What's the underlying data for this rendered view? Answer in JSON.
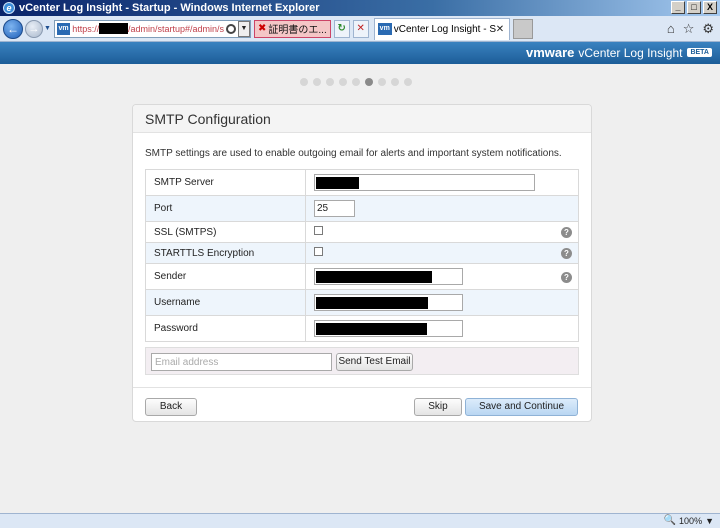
{
  "window": {
    "title": "vCenter Log Insight - Startup - Windows Internet Explorer",
    "app_icon": "ie-icon",
    "buttons": [
      "_",
      "□",
      "X"
    ]
  },
  "browser": {
    "address_prefix": "https://",
    "address_suffix": "/admin/startup#/admin/s",
    "cert_error": "証明書のエ...",
    "tab_title": "vCenter Log Insight - Start...",
    "tab_close": "✕",
    "icons": [
      "back-icon",
      "forward-icon",
      "search-icon",
      "refresh-icon",
      "stop-icon",
      "home-icon",
      "favorites-icon",
      "tools-icon"
    ]
  },
  "header": {
    "logo": "vmware",
    "product": "vCenter Log Insight",
    "badge": "BETA"
  },
  "wizard": {
    "total_steps": 9,
    "current_step": 6
  },
  "panel": {
    "title": "SMTP Configuration",
    "description": "SMTP settings are used to enable outgoing email for alerts and important system notifications.",
    "fields": {
      "server_label": "SMTP Server",
      "port_label": "Port",
      "port_value": "25",
      "ssl_label": "SSL (SMTPS)",
      "ssl_checked": false,
      "starttls_label": "STARTTLS Encryption",
      "starttls_checked": false,
      "sender_label": "Sender",
      "username_label": "Username",
      "password_label": "Password"
    },
    "test": {
      "placeholder": "Email address",
      "button": "Send Test Email"
    },
    "buttons": {
      "back": "Back",
      "skip": "Skip",
      "save": "Save and Continue"
    }
  },
  "status": {
    "zoom": "100%"
  }
}
